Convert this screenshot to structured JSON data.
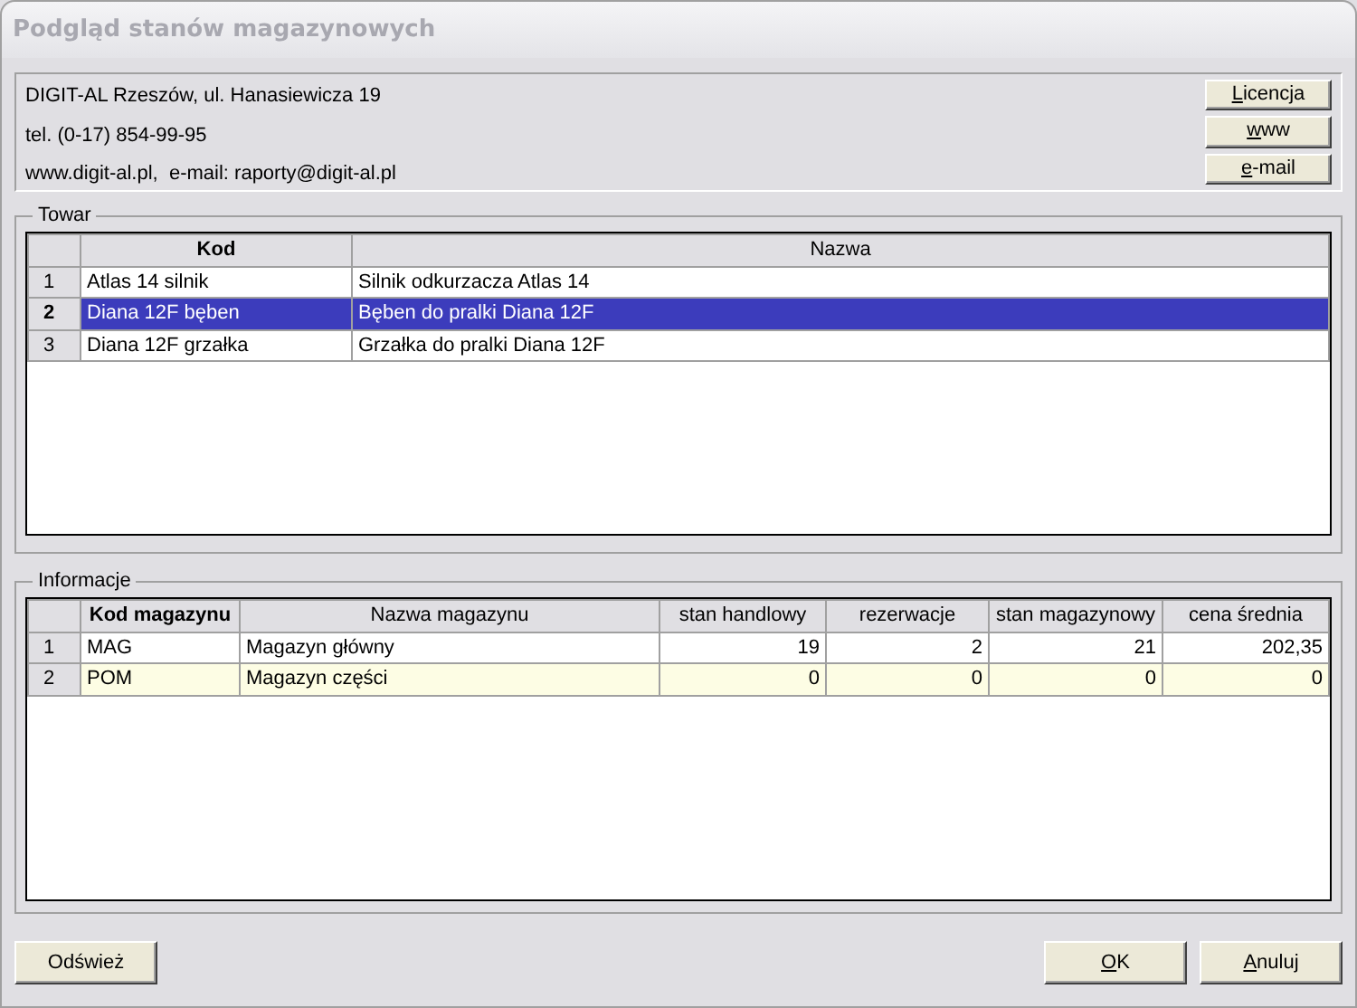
{
  "window": {
    "title": "Podgląd stanów magazynowych"
  },
  "company": {
    "lines": [
      "DIGIT-AL Rzeszów, ul. Hanasiewicza 19",
      "tel. (0-17) 854-99-95",
      "www.digit-al.pl,  e-mail: raporty@digit-al.pl"
    ],
    "buttons": [
      {
        "label": "Licencja",
        "access_key": true
      },
      {
        "label": "www",
        "access_key": true
      },
      {
        "label": "e-mail",
        "access_key": true
      }
    ]
  },
  "products": {
    "title": "Towar",
    "columns": [
      {
        "label": "Kod",
        "bold": true
      },
      {
        "label": "Nazwa",
        "bold": false
      }
    ],
    "rows": [
      {
        "number": "1",
        "cells": [
          "Atlas 14 silnik",
          "Silnik odkurzacza Atlas 14"
        ],
        "selected": false
      },
      {
        "number": "2",
        "cells": [
          "Diana 12F bęben",
          "Bęben do pralki Diana 12F"
        ],
        "selected": true
      },
      {
        "number": "3",
        "cells": [
          "Diana 12F grzałka",
          "Grzałka do pralki Diana 12F"
        ],
        "selected": false
      }
    ]
  },
  "info": {
    "title": "Informacje",
    "columns": [
      {
        "label": "Kod magazynu",
        "bold": true
      },
      {
        "label": "Nazwa magazynu",
        "bold": false
      },
      {
        "label": "stan handlowy",
        "bold": false
      },
      {
        "label": "rezerwacje",
        "bold": false
      },
      {
        "label": "stan magazynowy",
        "bold": false
      },
      {
        "label": "cena średnia",
        "bold": false
      }
    ],
    "rows": [
      {
        "number": "1",
        "cells": [
          "MAG",
          "Magazyn główny",
          "19",
          "2",
          "21",
          "202,35"
        ],
        "highlighted": false
      },
      {
        "number": "2",
        "cells": [
          "POM",
          "Magazyn części",
          "0",
          "0",
          "0",
          "0"
        ],
        "highlighted": true
      }
    ]
  },
  "footer": {
    "left_buttons": [
      {
        "label": "Odśwież",
        "access_key": false
      }
    ],
    "right_buttons": [
      {
        "label": "OK",
        "access_key": true
      },
      {
        "label": "Anuluj",
        "access_key": true
      }
    ]
  }
}
